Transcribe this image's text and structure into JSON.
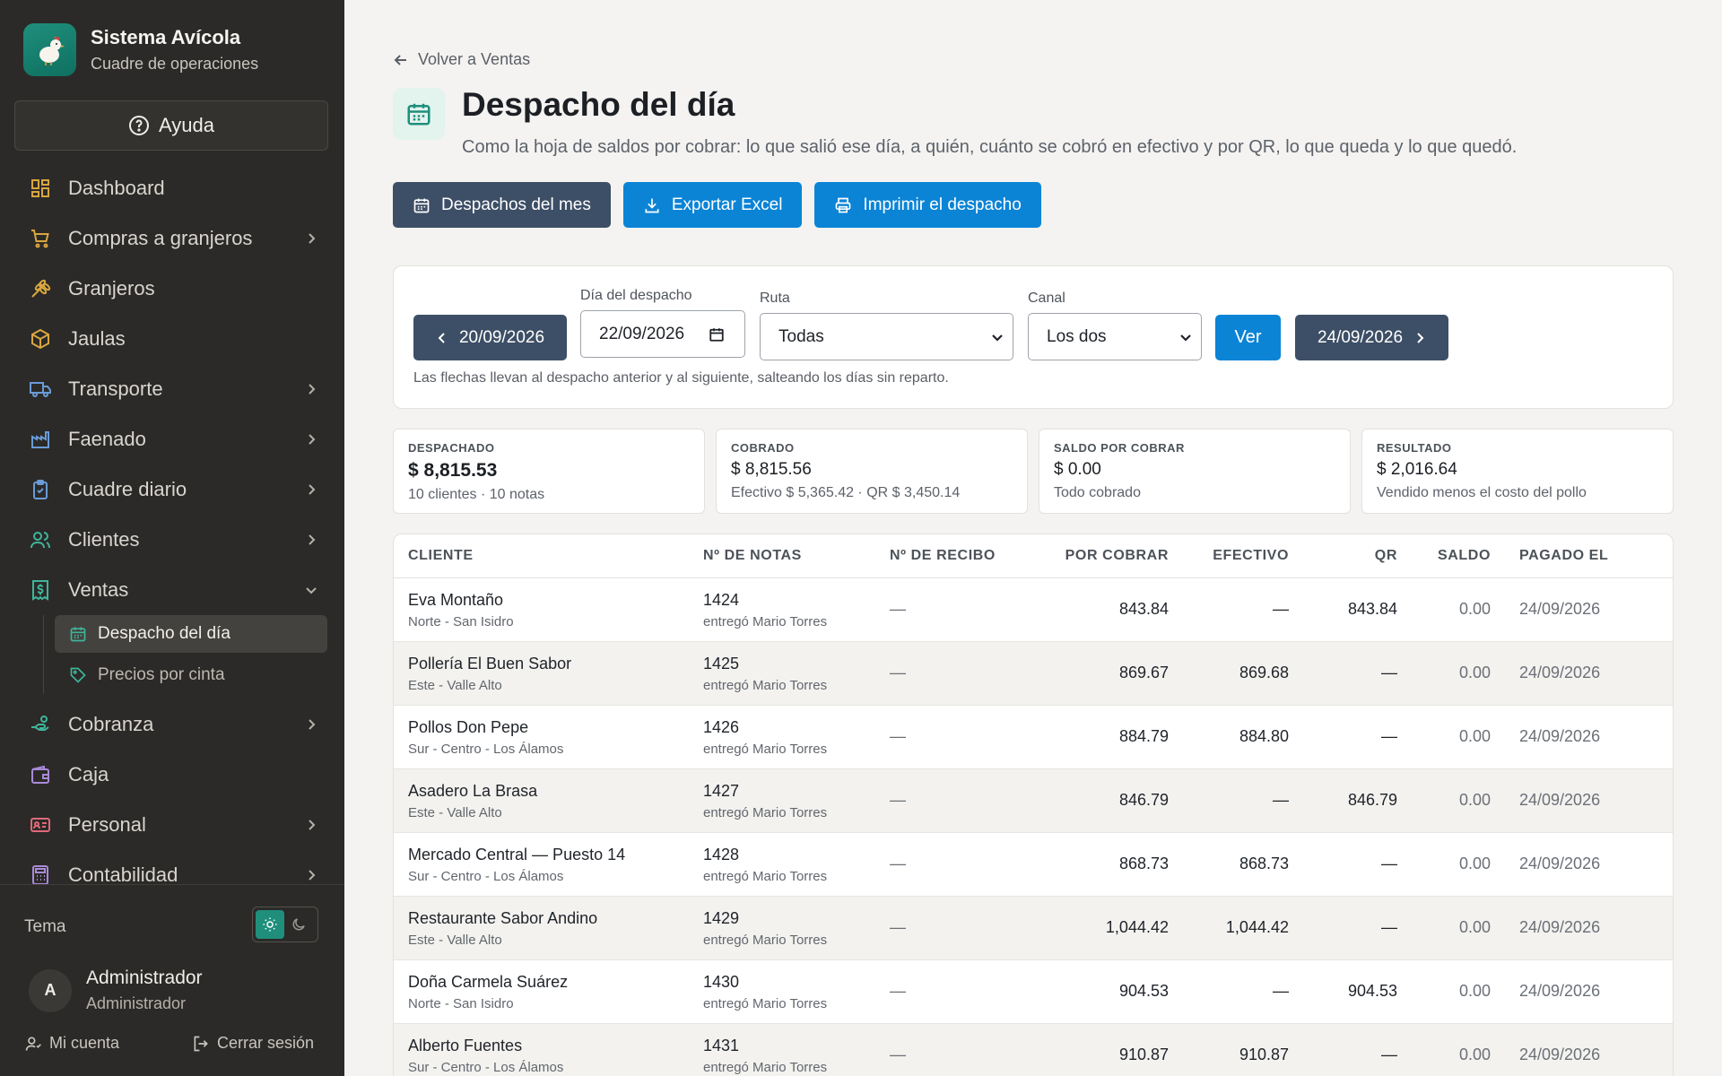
{
  "brand": {
    "title": "Sistema Avícola",
    "subtitle": "Cuadre de operaciones"
  },
  "help_label": "Ayuda",
  "nav": {
    "dashboard": "Dashboard",
    "compras": "Compras a granjeros",
    "granjeros": "Granjeros",
    "jaulas": "Jaulas",
    "transporte": "Transporte",
    "faenado": "Faenado",
    "cuadre": "Cuadre diario",
    "clientes": "Clientes",
    "ventas": "Ventas",
    "ventas_sub": {
      "despacho": "Despacho del día",
      "precios": "Precios por cinta"
    },
    "cobranza": "Cobranza",
    "caja": "Caja",
    "personal": "Personal",
    "contabilidad": "Contabilidad"
  },
  "theme_label": "Tema",
  "user": {
    "initial": "A",
    "name": "Administrador",
    "role": "Administrador",
    "account": "Mi cuenta",
    "logout": "Cerrar sesión"
  },
  "page": {
    "back": "Volver a Ventas",
    "title": "Despacho del día",
    "description": "Como la hoja de saldos por cobrar: lo que salió ese día, a quién, cuánto se cobró en efectivo y por QR, lo que queda y lo que quedó."
  },
  "actions": {
    "month": "Despachos del mes",
    "excel": "Exportar Excel",
    "print": "Imprimir el despacho"
  },
  "filters": {
    "prev_date": "20/09/2026",
    "day_label": "Día del despacho",
    "day_value": "22/09/2026",
    "route_label": "Ruta",
    "route_value": "Todas",
    "channel_label": "Canal",
    "channel_value": "Los dos",
    "ver": "Ver",
    "next_date": "24/09/2026",
    "note": "Las flechas llevan al despacho anterior y al siguiente, salteando los días sin reparto."
  },
  "summary": {
    "despachado": {
      "label": "DESPACHADO",
      "value": "$ 8,815.53",
      "sub": "10 clientes · 10 notas"
    },
    "cobrado": {
      "label": "COBRADO",
      "value": "$ 8,815.56",
      "sub": "Efectivo $ 5,365.42 · QR $ 3,450.14"
    },
    "saldo": {
      "label": "SALDO POR COBRAR",
      "value": "$ 0.00",
      "sub": "Todo cobrado"
    },
    "resultado": {
      "label": "RESULTADO",
      "value": "$ 2,016.64",
      "sub": "Vendido menos el costo del pollo"
    }
  },
  "table": {
    "headers": {
      "cliente": "CLIENTE",
      "notas": "Nº DE NOTAS",
      "recibo": "Nº DE RECIBO",
      "por_cobrar": "POR COBRAR",
      "efectivo": "EFECTIVO",
      "qr": "QR",
      "saldo": "SALDO",
      "pagado": "PAGADO EL"
    },
    "rows": [
      {
        "name": "Eva Montaño",
        "zone": "Norte - San Isidro",
        "nota": "1424",
        "entrego": "entregó Mario Torres",
        "recibo": "—",
        "por_cobrar": "843.84",
        "efectivo": "—",
        "qr": "843.84",
        "saldo": "0.00",
        "pagado": "24/09/2026"
      },
      {
        "name": "Pollería El Buen Sabor",
        "zone": "Este - Valle Alto",
        "nota": "1425",
        "entrego": "entregó Mario Torres",
        "recibo": "—",
        "por_cobrar": "869.67",
        "efectivo": "869.68",
        "qr": "—",
        "saldo": "0.00",
        "pagado": "24/09/2026"
      },
      {
        "name": "Pollos Don Pepe",
        "zone": "Sur - Centro - Los Álamos",
        "nota": "1426",
        "entrego": "entregó Mario Torres",
        "recibo": "—",
        "por_cobrar": "884.79",
        "efectivo": "884.80",
        "qr": "—",
        "saldo": "0.00",
        "pagado": "24/09/2026"
      },
      {
        "name": "Asadero La Brasa",
        "zone": "Este - Valle Alto",
        "nota": "1427",
        "entrego": "entregó Mario Torres",
        "recibo": "—",
        "por_cobrar": "846.79",
        "efectivo": "—",
        "qr": "846.79",
        "saldo": "0.00",
        "pagado": "24/09/2026"
      },
      {
        "name": "Mercado Central — Puesto 14",
        "zone": "Sur - Centro - Los Álamos",
        "nota": "1428",
        "entrego": "entregó Mario Torres",
        "recibo": "—",
        "por_cobrar": "868.73",
        "efectivo": "868.73",
        "qr": "—",
        "saldo": "0.00",
        "pagado": "24/09/2026"
      },
      {
        "name": "Restaurante Sabor Andino",
        "zone": "Este - Valle Alto",
        "nota": "1429",
        "entrego": "entregó Mario Torres",
        "recibo": "—",
        "por_cobrar": "1,044.42",
        "efectivo": "1,044.42",
        "qr": "—",
        "saldo": "0.00",
        "pagado": "24/09/2026"
      },
      {
        "name": "Doña Carmela Suárez",
        "zone": "Norte - San Isidro",
        "nota": "1430",
        "entrego": "entregó Mario Torres",
        "recibo": "—",
        "por_cobrar": "904.53",
        "efectivo": "—",
        "qr": "904.53",
        "saldo": "0.00",
        "pagado": "24/09/2026"
      },
      {
        "name": "Alberto Fuentes",
        "zone": "Sur - Centro - Los Álamos",
        "nota": "1431",
        "entrego": "entregó Mario Torres",
        "recibo": "—",
        "por_cobrar": "910.87",
        "efectivo": "910.87",
        "qr": "—",
        "saldo": "0.00",
        "pagado": "24/09/2026"
      }
    ]
  },
  "colors": {
    "accent": "#1f8f7c",
    "nav_icon": "#d9a640",
    "primary_button": "#0b84d6",
    "slate_button": "#3d4f66",
    "sidebar_bg": "#2b2a28"
  },
  "icons": [
    "chicken-logo-icon",
    "help-circle-icon",
    "grid-icon",
    "cart-icon",
    "wheat-icon",
    "box-icon",
    "truck-icon",
    "factory-icon",
    "clipboard-icon",
    "users-icon",
    "receipt-icon",
    "calendar-icon",
    "tag-icon",
    "hand-coins-icon",
    "wallet-icon",
    "id-card-icon",
    "calculator-icon",
    "sun-icon",
    "moon-icon",
    "arrow-left-icon",
    "download-icon",
    "printer-icon"
  ]
}
